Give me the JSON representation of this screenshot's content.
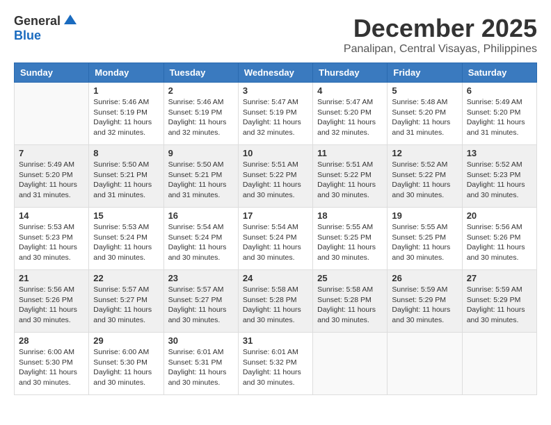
{
  "header": {
    "logo_general": "General",
    "logo_blue": "Blue",
    "month_title": "December 2025",
    "subtitle": "Panalipan, Central Visayas, Philippines"
  },
  "weekdays": [
    "Sunday",
    "Monday",
    "Tuesday",
    "Wednesday",
    "Thursday",
    "Friday",
    "Saturday"
  ],
  "weeks": [
    [
      {
        "day": "",
        "info": ""
      },
      {
        "day": "1",
        "info": "Sunrise: 5:46 AM\nSunset: 5:19 PM\nDaylight: 11 hours\nand 32 minutes."
      },
      {
        "day": "2",
        "info": "Sunrise: 5:46 AM\nSunset: 5:19 PM\nDaylight: 11 hours\nand 32 minutes."
      },
      {
        "day": "3",
        "info": "Sunrise: 5:47 AM\nSunset: 5:19 PM\nDaylight: 11 hours\nand 32 minutes."
      },
      {
        "day": "4",
        "info": "Sunrise: 5:47 AM\nSunset: 5:20 PM\nDaylight: 11 hours\nand 32 minutes."
      },
      {
        "day": "5",
        "info": "Sunrise: 5:48 AM\nSunset: 5:20 PM\nDaylight: 11 hours\nand 31 minutes."
      },
      {
        "day": "6",
        "info": "Sunrise: 5:49 AM\nSunset: 5:20 PM\nDaylight: 11 hours\nand 31 minutes."
      }
    ],
    [
      {
        "day": "7",
        "info": "Sunrise: 5:49 AM\nSunset: 5:20 PM\nDaylight: 11 hours\nand 31 minutes."
      },
      {
        "day": "8",
        "info": "Sunrise: 5:50 AM\nSunset: 5:21 PM\nDaylight: 11 hours\nand 31 minutes."
      },
      {
        "day": "9",
        "info": "Sunrise: 5:50 AM\nSunset: 5:21 PM\nDaylight: 11 hours\nand 31 minutes."
      },
      {
        "day": "10",
        "info": "Sunrise: 5:51 AM\nSunset: 5:22 PM\nDaylight: 11 hours\nand 30 minutes."
      },
      {
        "day": "11",
        "info": "Sunrise: 5:51 AM\nSunset: 5:22 PM\nDaylight: 11 hours\nand 30 minutes."
      },
      {
        "day": "12",
        "info": "Sunrise: 5:52 AM\nSunset: 5:22 PM\nDaylight: 11 hours\nand 30 minutes."
      },
      {
        "day": "13",
        "info": "Sunrise: 5:52 AM\nSunset: 5:23 PM\nDaylight: 11 hours\nand 30 minutes."
      }
    ],
    [
      {
        "day": "14",
        "info": "Sunrise: 5:53 AM\nSunset: 5:23 PM\nDaylight: 11 hours\nand 30 minutes."
      },
      {
        "day": "15",
        "info": "Sunrise: 5:53 AM\nSunset: 5:24 PM\nDaylight: 11 hours\nand 30 minutes."
      },
      {
        "day": "16",
        "info": "Sunrise: 5:54 AM\nSunset: 5:24 PM\nDaylight: 11 hours\nand 30 minutes."
      },
      {
        "day": "17",
        "info": "Sunrise: 5:54 AM\nSunset: 5:24 PM\nDaylight: 11 hours\nand 30 minutes."
      },
      {
        "day": "18",
        "info": "Sunrise: 5:55 AM\nSunset: 5:25 PM\nDaylight: 11 hours\nand 30 minutes."
      },
      {
        "day": "19",
        "info": "Sunrise: 5:55 AM\nSunset: 5:25 PM\nDaylight: 11 hours\nand 30 minutes."
      },
      {
        "day": "20",
        "info": "Sunrise: 5:56 AM\nSunset: 5:26 PM\nDaylight: 11 hours\nand 30 minutes."
      }
    ],
    [
      {
        "day": "21",
        "info": "Sunrise: 5:56 AM\nSunset: 5:26 PM\nDaylight: 11 hours\nand 30 minutes."
      },
      {
        "day": "22",
        "info": "Sunrise: 5:57 AM\nSunset: 5:27 PM\nDaylight: 11 hours\nand 30 minutes."
      },
      {
        "day": "23",
        "info": "Sunrise: 5:57 AM\nSunset: 5:27 PM\nDaylight: 11 hours\nand 30 minutes."
      },
      {
        "day": "24",
        "info": "Sunrise: 5:58 AM\nSunset: 5:28 PM\nDaylight: 11 hours\nand 30 minutes."
      },
      {
        "day": "25",
        "info": "Sunrise: 5:58 AM\nSunset: 5:28 PM\nDaylight: 11 hours\nand 30 minutes."
      },
      {
        "day": "26",
        "info": "Sunrise: 5:59 AM\nSunset: 5:29 PM\nDaylight: 11 hours\nand 30 minutes."
      },
      {
        "day": "27",
        "info": "Sunrise: 5:59 AM\nSunset: 5:29 PM\nDaylight: 11 hours\nand 30 minutes."
      }
    ],
    [
      {
        "day": "28",
        "info": "Sunrise: 6:00 AM\nSunset: 5:30 PM\nDaylight: 11 hours\nand 30 minutes."
      },
      {
        "day": "29",
        "info": "Sunrise: 6:00 AM\nSunset: 5:30 PM\nDaylight: 11 hours\nand 30 minutes."
      },
      {
        "day": "30",
        "info": "Sunrise: 6:01 AM\nSunset: 5:31 PM\nDaylight: 11 hours\nand 30 minutes."
      },
      {
        "day": "31",
        "info": "Sunrise: 6:01 AM\nSunset: 5:32 PM\nDaylight: 11 hours\nand 30 minutes."
      },
      {
        "day": "",
        "info": ""
      },
      {
        "day": "",
        "info": ""
      },
      {
        "day": "",
        "info": ""
      }
    ]
  ]
}
